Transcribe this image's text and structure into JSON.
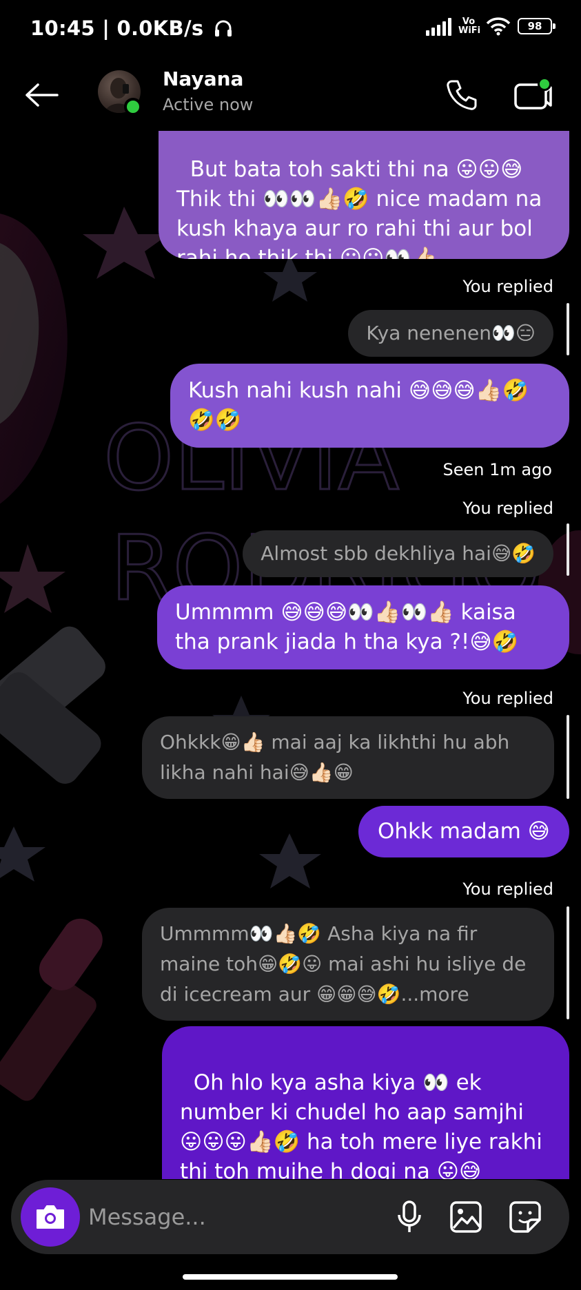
{
  "status_bar": {
    "time_speed": "10:45 | 0.0KB/s",
    "headphone_icon": "headphone-icon",
    "vowifi": "Vo WiFi",
    "battery": "98"
  },
  "header": {
    "contact_name": "Nayana",
    "contact_status": "Active now"
  },
  "messages": [
    {
      "type": "sent",
      "text": "But bata toh sakti thi na 😛😛😅\nThik thi 👀👀👍🏻🤣 nice madam na kush khaya aur ro rahi thi aur bol rahi ho thik thi 😛😛👀👍🏻"
    },
    {
      "type": "replied_label",
      "text": "You replied"
    },
    {
      "type": "reply_quote",
      "text": "Kya nenenen👀😑"
    },
    {
      "type": "sent",
      "text": "Kush nahi kush nahi 😅😅😅👍🏻🤣🤣🤣"
    },
    {
      "type": "seen",
      "text": "Seen 1m ago"
    },
    {
      "type": "replied_label",
      "text": "You replied"
    },
    {
      "type": "reply_quote",
      "text": "Almost sbb dekhliya hai😅🤣"
    },
    {
      "type": "sent",
      "text": "Ummmm 😅😅😅👀👍🏻👀👍🏻 kaisa tha prank jiada h tha kya ?!😅🤣"
    },
    {
      "type": "replied_label",
      "text": "You replied"
    },
    {
      "type": "reply_quote",
      "text": "Ohkkk😁👍🏻 mai aaj ka likhthi hu abh likha nahi hai😅👍🏻😁"
    },
    {
      "type": "sent",
      "text": "Ohkk madam 😅"
    },
    {
      "type": "replied_label",
      "text": "You replied"
    },
    {
      "type": "reply_quote",
      "text": "Ummmm👀👍🏻🤣 Asha kiya na fir maine toh😁🤣😛 mai ashi hu isliye de di icecream aur 😁😁😅🤣...more"
    },
    {
      "type": "sent",
      "text": "Oh hlo kya asha kiya 👀 ek number ki chudel ho aap samjhi 😛😛😛👍🏻🤣 ha toh mere liye rakhi thi toh mujhe h dogi na 😛😅\nAiseeee hhhhhh 😅😅 nahi khel"
    }
  ],
  "composer": {
    "placeholder": "Message..."
  },
  "colors": {
    "accent_purple": "#6e1ed6",
    "bubble_light": "#8a5bc4",
    "bubble_dark": "#5f17c7",
    "reply_bg": "#262628",
    "online_green": "#2fcc3f"
  },
  "icons": [
    "back-arrow-icon",
    "phone-icon",
    "video-camera-icon",
    "camera-icon",
    "microphone-icon",
    "gallery-icon",
    "sticker-icon"
  ]
}
